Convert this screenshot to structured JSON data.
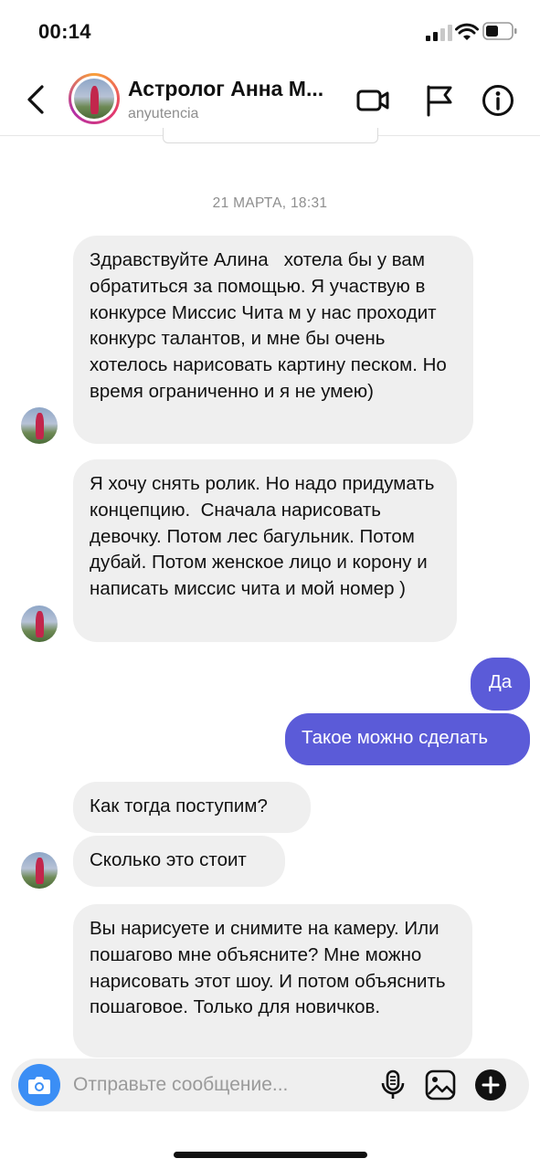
{
  "status_bar": {
    "time": "00:14"
  },
  "header": {
    "title": "Астролог Анна М...",
    "username": "anyutencia",
    "icons": [
      "back-arrow-icon",
      "video-call-icon",
      "flag-icon",
      "info-icon"
    ]
  },
  "conversation": {
    "date": "21 МАРТА, 18:31",
    "messages": [
      {
        "from": "them",
        "text": "Здравствуйте Алина   хотела бы у вам обратиться за помощью. Я участвую в конкурсе Миссис Чита м у нас проходит конкурс талантов, и мне бы очень хотелось нарисовать картину песком. Но время ограниченно и я не умею)"
      },
      {
        "from": "them",
        "text": "Я хочу снять ролик. Но надо придумать концепцию.  Сначала нарисовать девочку. Потом лес багульник. Потом дубай. Потом женское лицо и корону и написать миссис чита и мой номер )"
      },
      {
        "from": "me",
        "text": "Да"
      },
      {
        "from": "me",
        "text": "Такое можно сделать"
      },
      {
        "from": "them",
        "text": "Как тогда поступим?"
      },
      {
        "from": "them",
        "text": "Сколько это стоит"
      },
      {
        "from": "them",
        "text": "Вы нарисуете и снимите на камеру. Или пошагово мне объясните? Мне можно нарисовать этот шоу. И потом объяснить пошаговое. Только для новичков."
      }
    ]
  },
  "composer": {
    "placeholder": "Отправьте сообщение..."
  },
  "colors": {
    "outgoing_bubble": "#5b5bd8",
    "incoming_bubble": "#efefef",
    "camera_button": "#3b8ef5"
  }
}
